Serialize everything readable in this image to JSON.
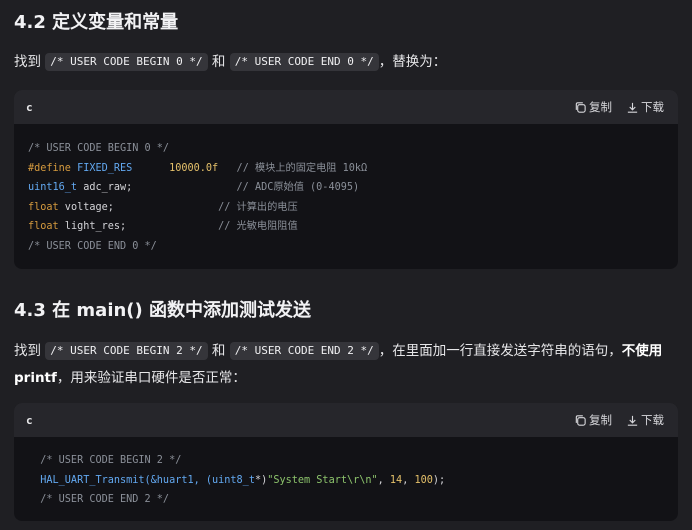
{
  "section1": {
    "heading": "4.2 定义变量和常量",
    "para_prefix": "找到",
    "code_begin": "/* USER CODE BEGIN 0 */",
    "and_word": "和",
    "code_end": "/* USER CODE END 0 */",
    "para_suffix": "，替换为："
  },
  "codeblock1": {
    "lang": "c",
    "copy_label": "复制",
    "download_label": "下载",
    "lines": {
      "l1": "/* USER CODE BEGIN 0 */",
      "l2_kw": "#define",
      "l2_name": " FIXED_RES      ",
      "l2_num": "10000.0f",
      "l2_comment": "   // 模块上的固定电阻 10kΩ",
      "l3_type": "uint16_t",
      "l3_rest": " adc_raw;                 ",
      "l3_comment": "// ADC原始值 (0-4095)",
      "l4_type": "float",
      "l4_rest": " voltage;                 ",
      "l4_comment": "// 计算出的电压",
      "l5_type": "float",
      "l5_rest": " light_res;               ",
      "l5_comment": "// 光敏电阻阻值",
      "l6": "/* USER CODE END 0 */"
    }
  },
  "section2": {
    "heading": "4.3 在 main() 函数中添加测试发送",
    "para_prefix": "找到",
    "code_begin": "/* USER CODE BEGIN 2 */",
    "and_word": "和",
    "code_end": "/* USER CODE END 2 */",
    "para_mid": "，在里面加一行直接发送字符串的语句，",
    "para_bold": "不使用 printf",
    "para_suffix": "，用来验证串口硬件是否正常："
  },
  "codeblock2": {
    "lang": "c",
    "copy_label": "复制",
    "download_label": "下载",
    "lines": {
      "l1": "  /* USER CODE BEGIN 2 */",
      "l2_a": "  HAL_UART_Transmit(&huart1, (",
      "l2_type": "uint8_t",
      "l2_b": "*)",
      "l2_str": "\"System Start\\r\\n\"",
      "l2_c": ", ",
      "l2_n1": "14",
      "l2_d": ", ",
      "l2_n2": "100",
      "l2_e": ");",
      "l3": "  /* USER CODE END 2 */"
    }
  }
}
